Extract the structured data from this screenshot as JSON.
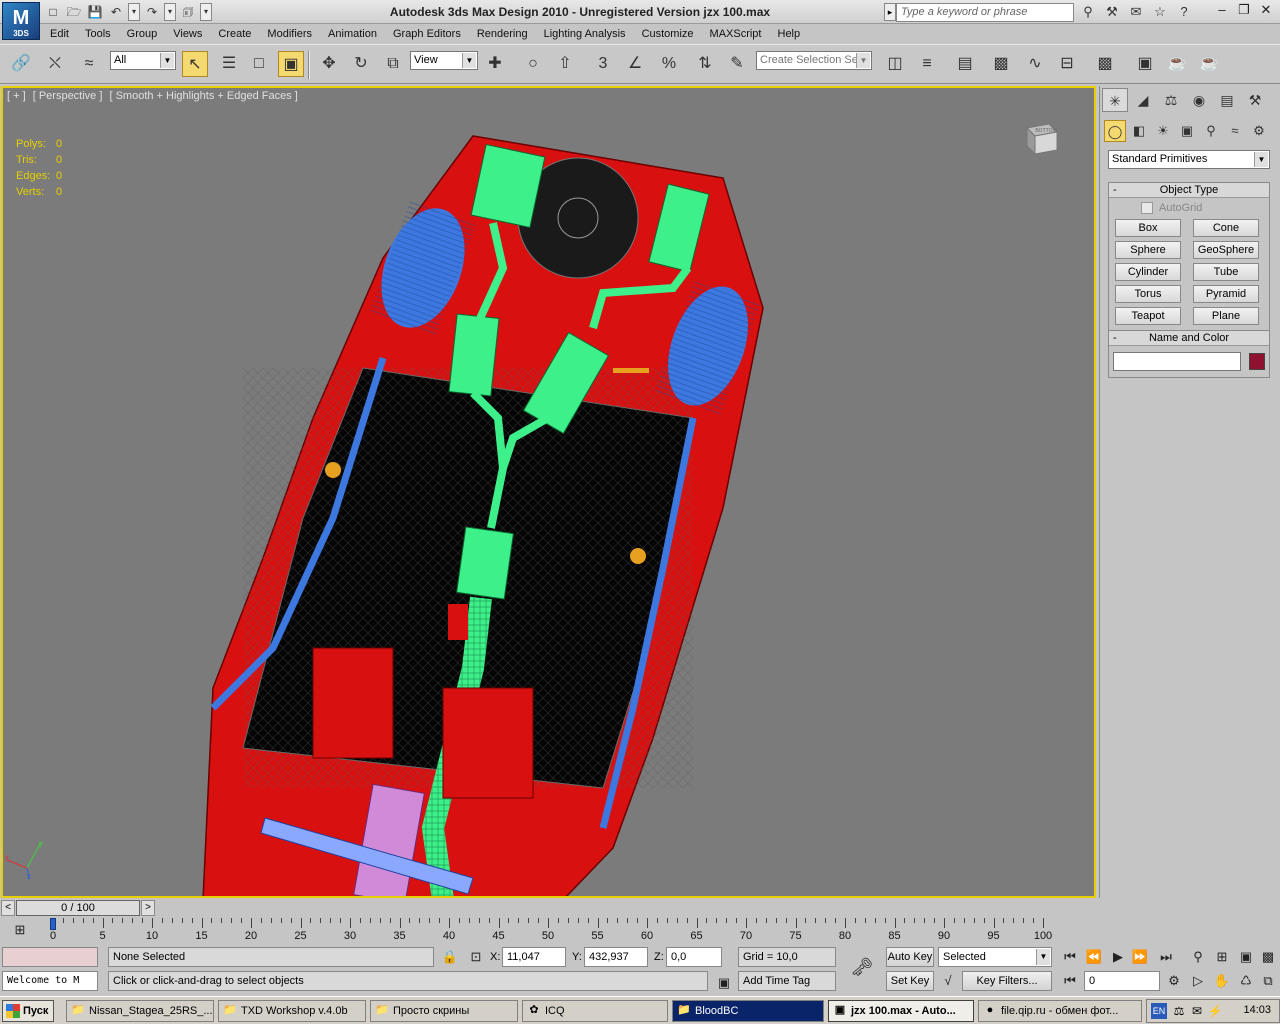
{
  "app": {
    "logo_text": "M",
    "logo_sub": "3DS",
    "title": "Autodesk 3ds Max Design 2010  - Unregistered Version   jzx 100.max",
    "search_placeholder": "Type a keyword or phrase"
  },
  "menu": [
    "Edit",
    "Tools",
    "Group",
    "Views",
    "Create",
    "Modifiers",
    "Animation",
    "Graph Editors",
    "Rendering",
    "Lighting Analysis",
    "Customize",
    "MAXScript",
    "Help"
  ],
  "toolbar": {
    "selection_filter": "All",
    "ref_coord": "View",
    "selection_set_placeholder": "Create Selection Se",
    "snap_label": "3",
    "percent_label": "%"
  },
  "viewport": {
    "labels": [
      "[ + ]",
      "[ Perspective ]",
      "[ Smooth + Highlights + Edged Faces ]"
    ],
    "viewcube_label": "BOTTOM",
    "stats": [
      {
        "k": "Polys:",
        "v": "0"
      },
      {
        "k": "Tris:",
        "v": "0"
      },
      {
        "k": "Edges:",
        "v": "0"
      },
      {
        "k": "Verts:",
        "v": "0"
      }
    ],
    "colors": {
      "background": "#7b7b7b",
      "body": "#e01414",
      "exhaust": "#3ef08a",
      "wheels": "#3c78e0",
      "frame": "#8888ff"
    }
  },
  "command_panel": {
    "category": "Standard Primitives",
    "object_type_title": "Object Type",
    "autogrid": "AutoGrid",
    "primitives": [
      "Box",
      "Cone",
      "Sphere",
      "GeoSphere",
      "Cylinder",
      "Tube",
      "Torus",
      "Pyramid",
      "Teapot",
      "Plane"
    ],
    "name_color_title": "Name and Color",
    "object_name": "",
    "color": "#8e1230"
  },
  "timeline": {
    "frame_display": "0 / 100",
    "ticks": [
      "0",
      "5",
      "10",
      "15",
      "20",
      "25",
      "30",
      "35",
      "40",
      "45",
      "50",
      "55",
      "60",
      "65",
      "70",
      "75",
      "80",
      "85",
      "90",
      "95",
      "100"
    ]
  },
  "status": {
    "script_listener": "Welcome to M",
    "selection": "None Selected",
    "prompt": "Click or click-and-drag to select objects",
    "x_label": "X:",
    "x_value": "11,047",
    "y_label": "Y:",
    "y_value": "432,937",
    "z_label": "Z:",
    "z_value": "0,0",
    "grid": "Grid = 10,0",
    "add_time_tag": "Add Time Tag",
    "auto_key": "Auto Key",
    "set_key": "Set Key",
    "key_mode": "Selected",
    "key_filters": "Key Filters...",
    "current_frame": "0"
  },
  "taskbar": {
    "start": "Пуск",
    "tasks": [
      {
        "label": "Nissan_Stagea_25RS_...",
        "icon": "folder-icon"
      },
      {
        "label": "TXD Workshop v.4.0b",
        "icon": "folder-icon"
      },
      {
        "label": "Просто скрины",
        "icon": "folder-icon"
      },
      {
        "label": "ICQ",
        "icon": "icq-icon"
      },
      {
        "label": "BloodBC",
        "icon": "folder-icon"
      },
      {
        "label": "jzx 100.max - Auto...",
        "icon": "3dsmax-icon"
      },
      {
        "label": "file.qip.ru - обмен фот...",
        "icon": "firefox-icon"
      }
    ],
    "lang": "EN",
    "clock": "14:03"
  }
}
